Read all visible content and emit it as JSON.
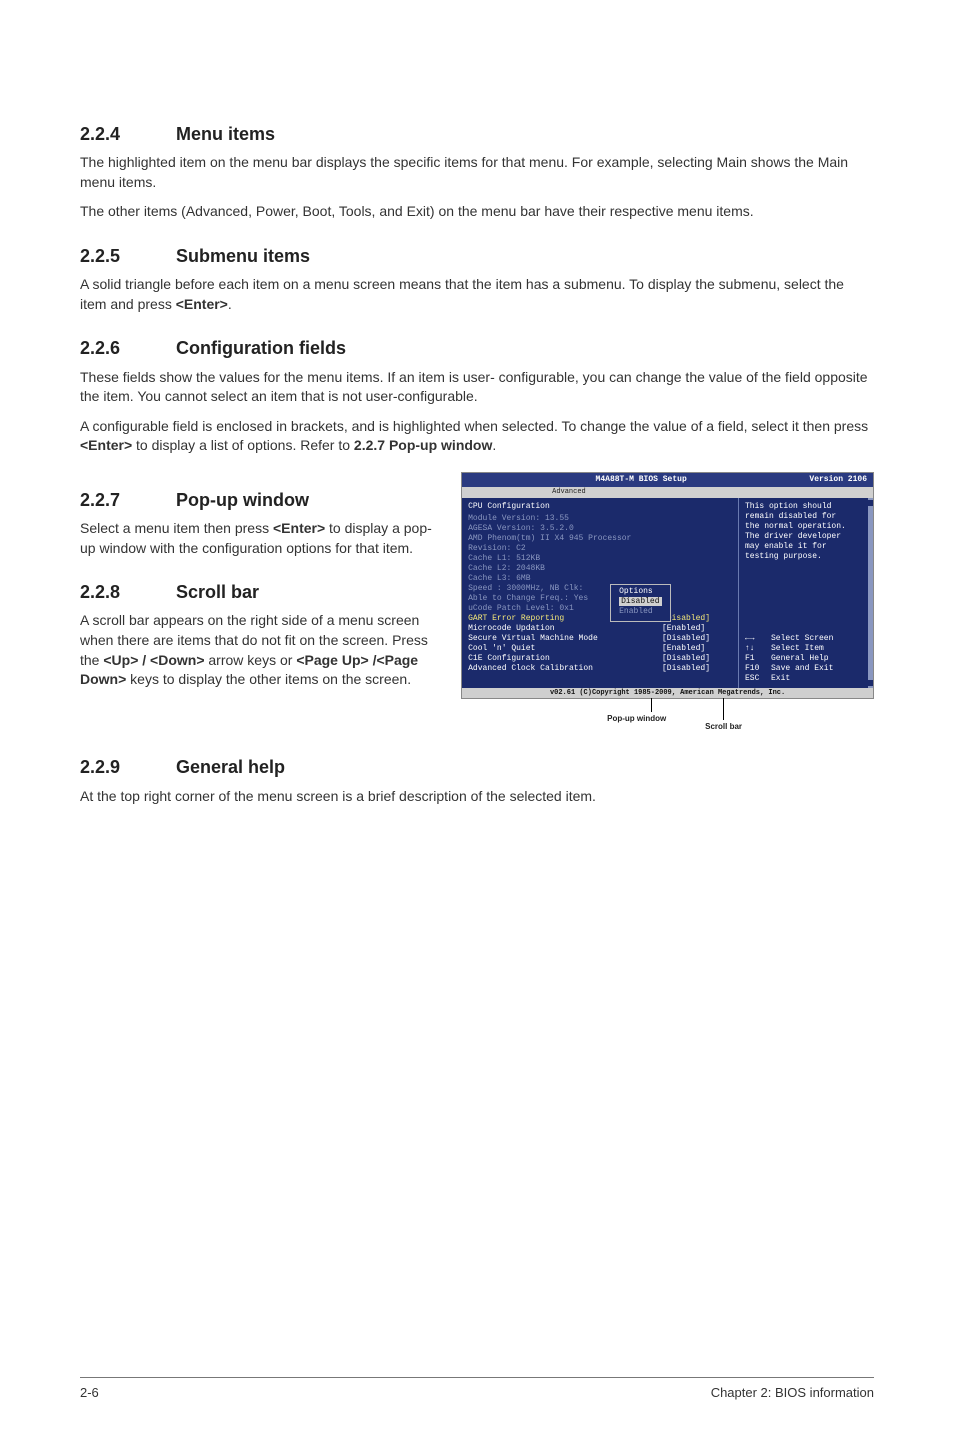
{
  "sections": {
    "s224": {
      "num": "2.2.4",
      "title": "Menu items",
      "p1": "The highlighted item on the menu bar displays the specific items for that menu. For example, selecting Main shows the Main menu items.",
      "p2": "The other items (Advanced, Power, Boot, Tools, and Exit) on the menu bar have their respective menu items."
    },
    "s225": {
      "num": "2.2.5",
      "title": "Submenu items",
      "p1a": "A solid triangle before each item on a menu screen means that the item has a submenu. To display the submenu, select the item and press ",
      "p1b": "<Enter>",
      "p1c": "."
    },
    "s226": {
      "num": "2.2.6",
      "title": "Configuration fields",
      "p1": "These fields show the values for the menu items. If an item is user- configurable, you can change the value of the field opposite the item. You cannot select an item that is not user-configurable.",
      "p2a": "A configurable field is enclosed in brackets, and is highlighted when selected. To change the value of a field, select it then press ",
      "p2b": "<Enter>",
      "p2c": " to display a list of options. Refer to ",
      "p2d": "2.2.7 Pop-up window",
      "p2e": "."
    },
    "s227": {
      "num": "2.2.7",
      "title": "Pop-up window",
      "p1a": "Select a menu item then press ",
      "p1b": "<Enter>",
      "p1c": " to display a pop-up window with the configuration options for that item."
    },
    "s228": {
      "num": "2.2.8",
      "title": "Scroll bar",
      "p1a": "A scroll bar appears on the right side of a menu screen when there are items that do not fit on the screen. Press the ",
      "p1b": "<Up> / <Down>",
      "p1c": " arrow keys or ",
      "p1d": "<Page Up> /<Page Down>",
      "p1e": " keys to display the other items on the screen."
    },
    "s229": {
      "num": "2.2.9",
      "title": "General help",
      "p1": "At the top right corner of the menu screen is a brief description of the selected item."
    }
  },
  "bios": {
    "title_center": "M4A88T-M BIOS Setup",
    "title_right": "Version 2106",
    "menubar_selected": "Advanced",
    "heading": "CPU Configuration",
    "gray_lines": [
      "Module Version: 13.55",
      "AGESA Version: 3.5.2.0",
      "",
      "AMD Phenom(tm) II X4 945 Processor",
      "Revision: C2",
      "Cache L1: 512KB",
      "Cache L2: 2048KB",
      "Cache L3: 6MB",
      "Speed : 3000MHz, NB Clk:",
      "Able to Change Freq.: Yes",
      "uCode Patch Level: 0x1"
    ],
    "settings": [
      {
        "label": "GART Error Reporting",
        "value": "[Disabled]",
        "highlight": true
      },
      {
        "label": "Microcode Updation",
        "value": "[Enabled]"
      },
      {
        "label": "Secure Virtual Machine Mode",
        "value": "[Disabled]"
      },
      {
        "label": "Cool 'n' Quiet",
        "value": "[Enabled]"
      },
      {
        "label": "C1E Configuration",
        "value": "[Disabled]"
      },
      {
        "label": "Advanced Clock Calibration",
        "value": "[Disabled]"
      }
    ],
    "popup": {
      "title": "Options",
      "selected": "Disabled",
      "other": "Enabled"
    },
    "help_text": [
      "This option should",
      "remain disabled for",
      "the normal operation.",
      "The driver developer",
      "may enable it for",
      "testing purpose."
    ],
    "keys": [
      {
        "glyph": "←→",
        "label": "Select Screen"
      },
      {
        "glyph": "↑↓",
        "label": "Select Item"
      },
      {
        "glyph": "F1",
        "label": "General Help"
      },
      {
        "glyph": "F10",
        "label": "Save and Exit"
      },
      {
        "glyph": "ESC",
        "label": "Exit"
      }
    ],
    "footer": "v02.61 (C)Copyright 1985-2009, American Megatrends, Inc.",
    "callout_popup": "Pop-up window",
    "callout_scroll": "Scroll bar"
  },
  "footer": {
    "left": "2-6",
    "right": "Chapter 2: BIOS information"
  }
}
